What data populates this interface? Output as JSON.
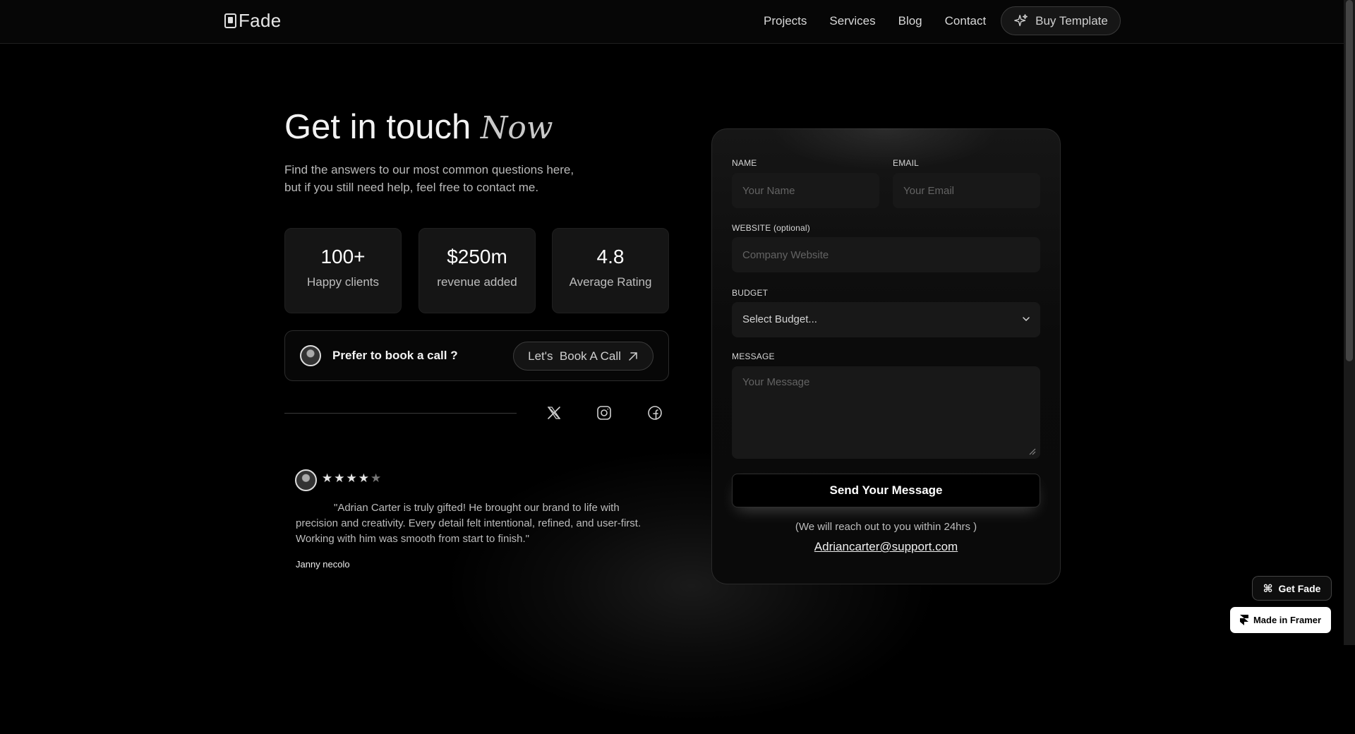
{
  "header": {
    "logo_text": "Fade",
    "nav": [
      "Projects",
      "Services",
      "Blog",
      "Contact"
    ],
    "buy_button": "Buy Template"
  },
  "hero": {
    "title": "Get in touch",
    "title_accent": "Now",
    "subtitle_lines": [
      "Find the answers to our most common questions here,",
      "but if you still need help, feel free to contact me."
    ]
  },
  "stats": [
    {
      "value": "100+",
      "label": "Happy clients"
    },
    {
      "value": "$250m",
      "label": "revenue added"
    },
    {
      "value": "4.8",
      "label": "Average Rating"
    }
  ],
  "call": {
    "text": "Prefer to book a call ?",
    "button": "Let's  Book A Call"
  },
  "social_icons": [
    "x-icon",
    "instagram-icon",
    "facebook-icon"
  ],
  "review": {
    "rating": 4,
    "max_rating": 5,
    "text": "\"Adrian Carter is truly gifted! He brought our brand to life with precision and creativity. Every detail felt intentional, refined, and user-first. Working with him was smooth from start to finish.\"",
    "author": "Janny necolo"
  },
  "form": {
    "name_label": "NAME",
    "name_placeholder": "Your Name",
    "email_label": "EMAIL",
    "email_placeholder": "Your Email",
    "website_label": "WEBSITE (optional)",
    "website_placeholder": "Company Website",
    "budget_label": "BUDGET",
    "budget_selected": "Select Budget...",
    "message_label": "MESSAGE",
    "message_placeholder": "Your Message",
    "submit": "Send Your Message",
    "note": "(We will reach out to you within 24hrs )",
    "email": "Adriancarter@support.com"
  },
  "badges": {
    "get_fade": "Get Fade",
    "framer": "Made in Framer"
  }
}
